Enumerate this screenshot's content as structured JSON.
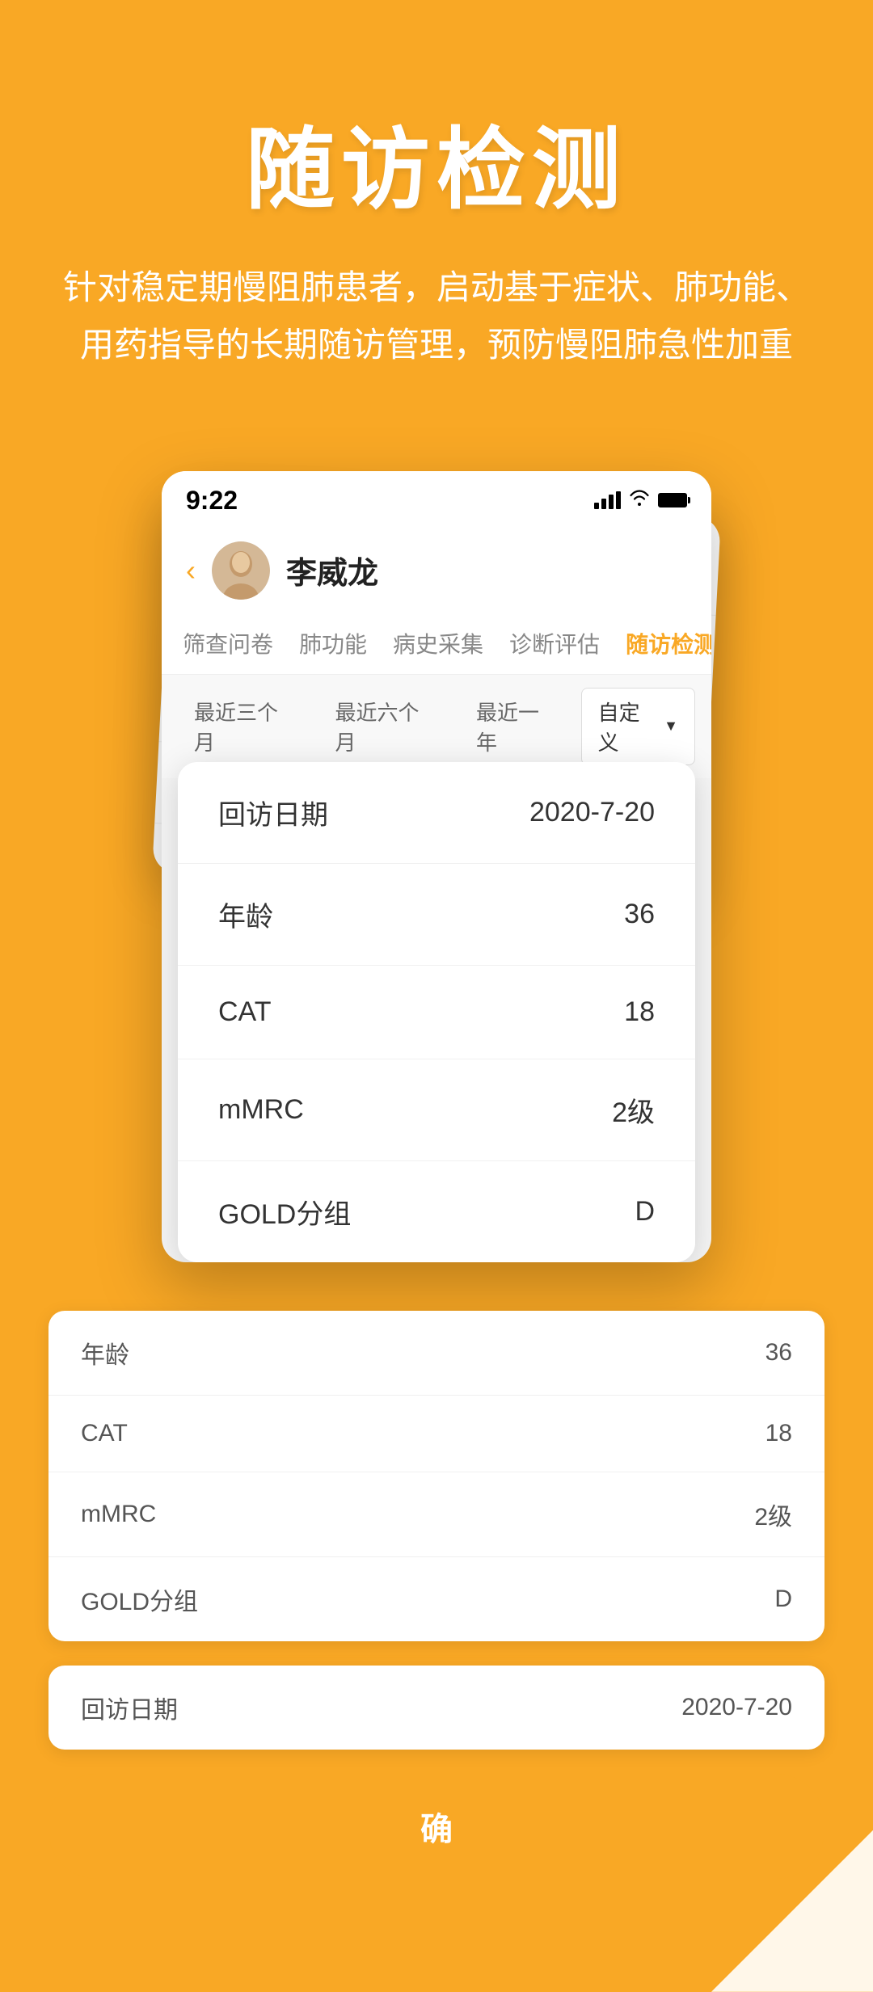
{
  "header": {
    "title": "随访检测",
    "subtitle": "针对稳定期慢阻肺患者，启动基于症状、肺功能、用药指导的长期随访管理，预防慢阻肺急性加重"
  },
  "status_bar": {
    "time": "9:22",
    "signal": "signal",
    "wifi": "wifi",
    "battery": "battery"
  },
  "patient": {
    "name": "李威龙"
  },
  "nav_tabs": [
    {
      "label": "筛查问卷",
      "active": false
    },
    {
      "label": "肺功能",
      "active": false
    },
    {
      "label": "病史采集",
      "active": false
    },
    {
      "label": "诊断评估",
      "active": false
    },
    {
      "label": "随访检测",
      "active": true,
      "highlighted": true
    }
  ],
  "date_filters": [
    {
      "label": "最近三个月"
    },
    {
      "label": "最近六个月"
    },
    {
      "label": "最近一年"
    },
    {
      "label": "自定义",
      "custom": true
    }
  ],
  "front_card": {
    "rows": [
      {
        "label": "回访日期",
        "value": "2020-7-20"
      },
      {
        "label": "年龄",
        "value": "36"
      },
      {
        "label": "CAT",
        "value": "18"
      },
      {
        "label": "mMRC",
        "value": "2级"
      },
      {
        "label": "GOLD分组",
        "value": "D"
      }
    ]
  },
  "back_card": {
    "rows": [
      {
        "label": "年龄",
        "value": "36"
      },
      {
        "label": "CAT",
        "value": "18"
      },
      {
        "label": "mMRC",
        "value": "2级"
      },
      {
        "label": "GOLD分组",
        "value": "D"
      }
    ]
  },
  "second_card": {
    "rows": [
      {
        "label": "回访日期",
        "value": "2020-7-20"
      }
    ]
  },
  "confirm_button": {
    "label": "确"
  }
}
